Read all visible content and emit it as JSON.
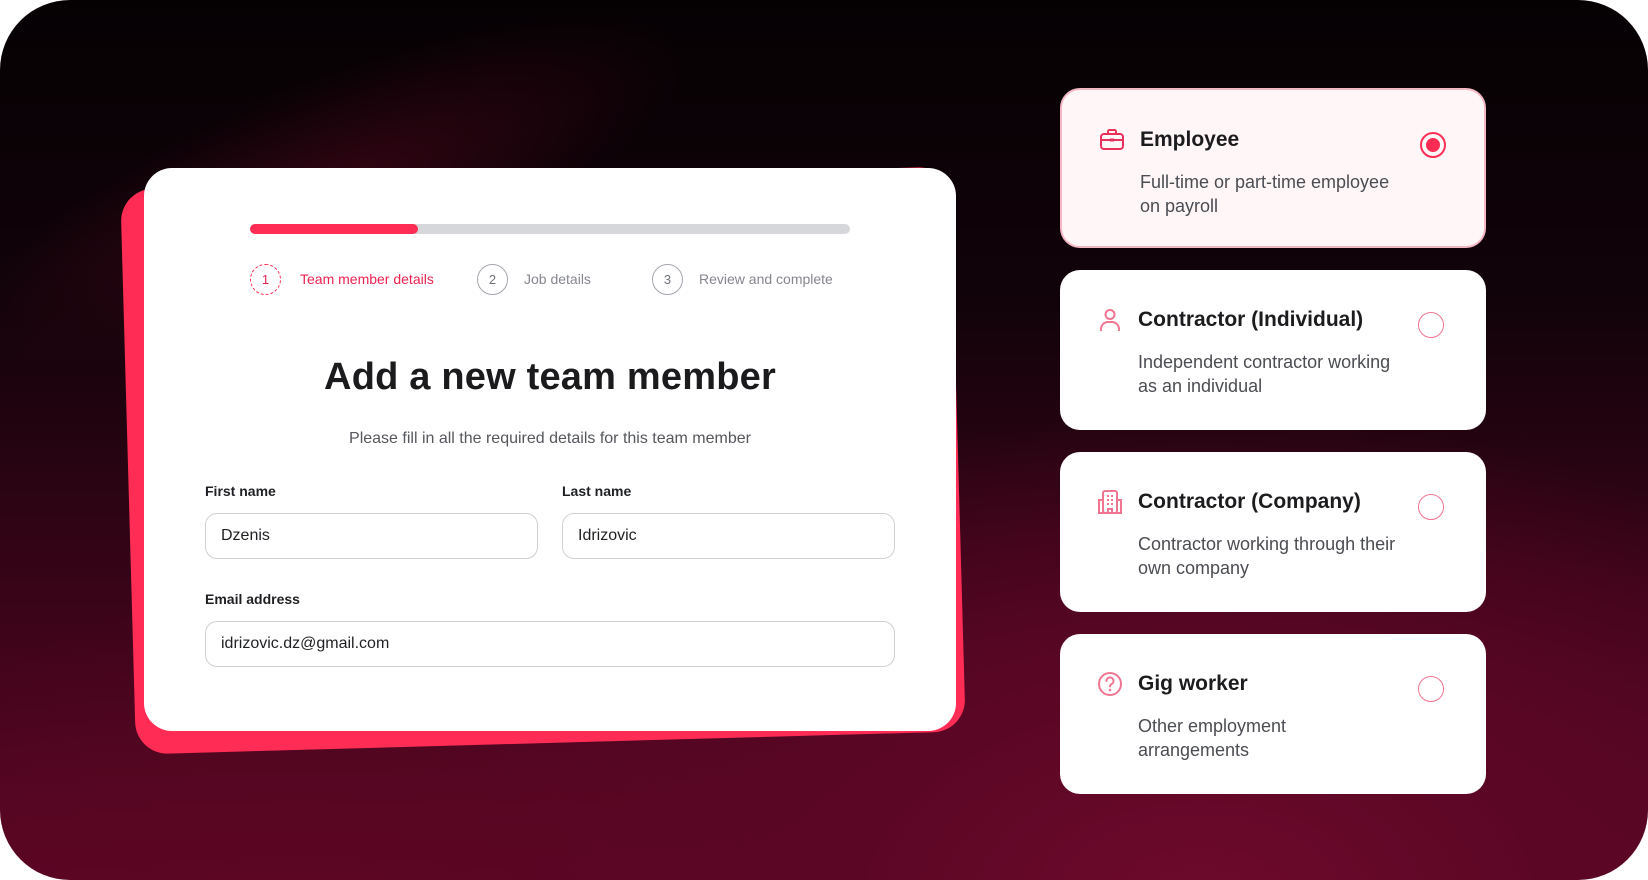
{
  "form": {
    "progress": 0.28,
    "steps": [
      {
        "number": "1",
        "label": "Team member details",
        "active": true
      },
      {
        "number": "2",
        "label": "Job details",
        "active": false
      },
      {
        "number": "3",
        "label": "Review and complete",
        "active": false
      }
    ],
    "title": "Add a new team member",
    "subtitle": "Please fill in all the required details for this team member",
    "first_name": {
      "label": "First name",
      "value": "Dzenis"
    },
    "last_name": {
      "label": "Last name",
      "value": "Idrizovic"
    },
    "email": {
      "label": "Email address",
      "value": "idrizovic.dz@gmail.com"
    }
  },
  "options": [
    {
      "title": "Employee",
      "description": "Full-time or part-time employee on payroll",
      "icon": "briefcase-icon",
      "selected": true
    },
    {
      "title": "Contractor (Individual)",
      "description": "Independent contractor working as an individual",
      "icon": "person-icon",
      "selected": false
    },
    {
      "title": "Contractor (Company)",
      "description": "Contractor working through their own company",
      "icon": "building-icon",
      "selected": false
    },
    {
      "title": "Gig worker",
      "description": "Other employment arrangements",
      "icon": "question-icon",
      "selected": false
    }
  ],
  "colors": {
    "accent": "#ff2d55",
    "background": "#3c0419"
  }
}
